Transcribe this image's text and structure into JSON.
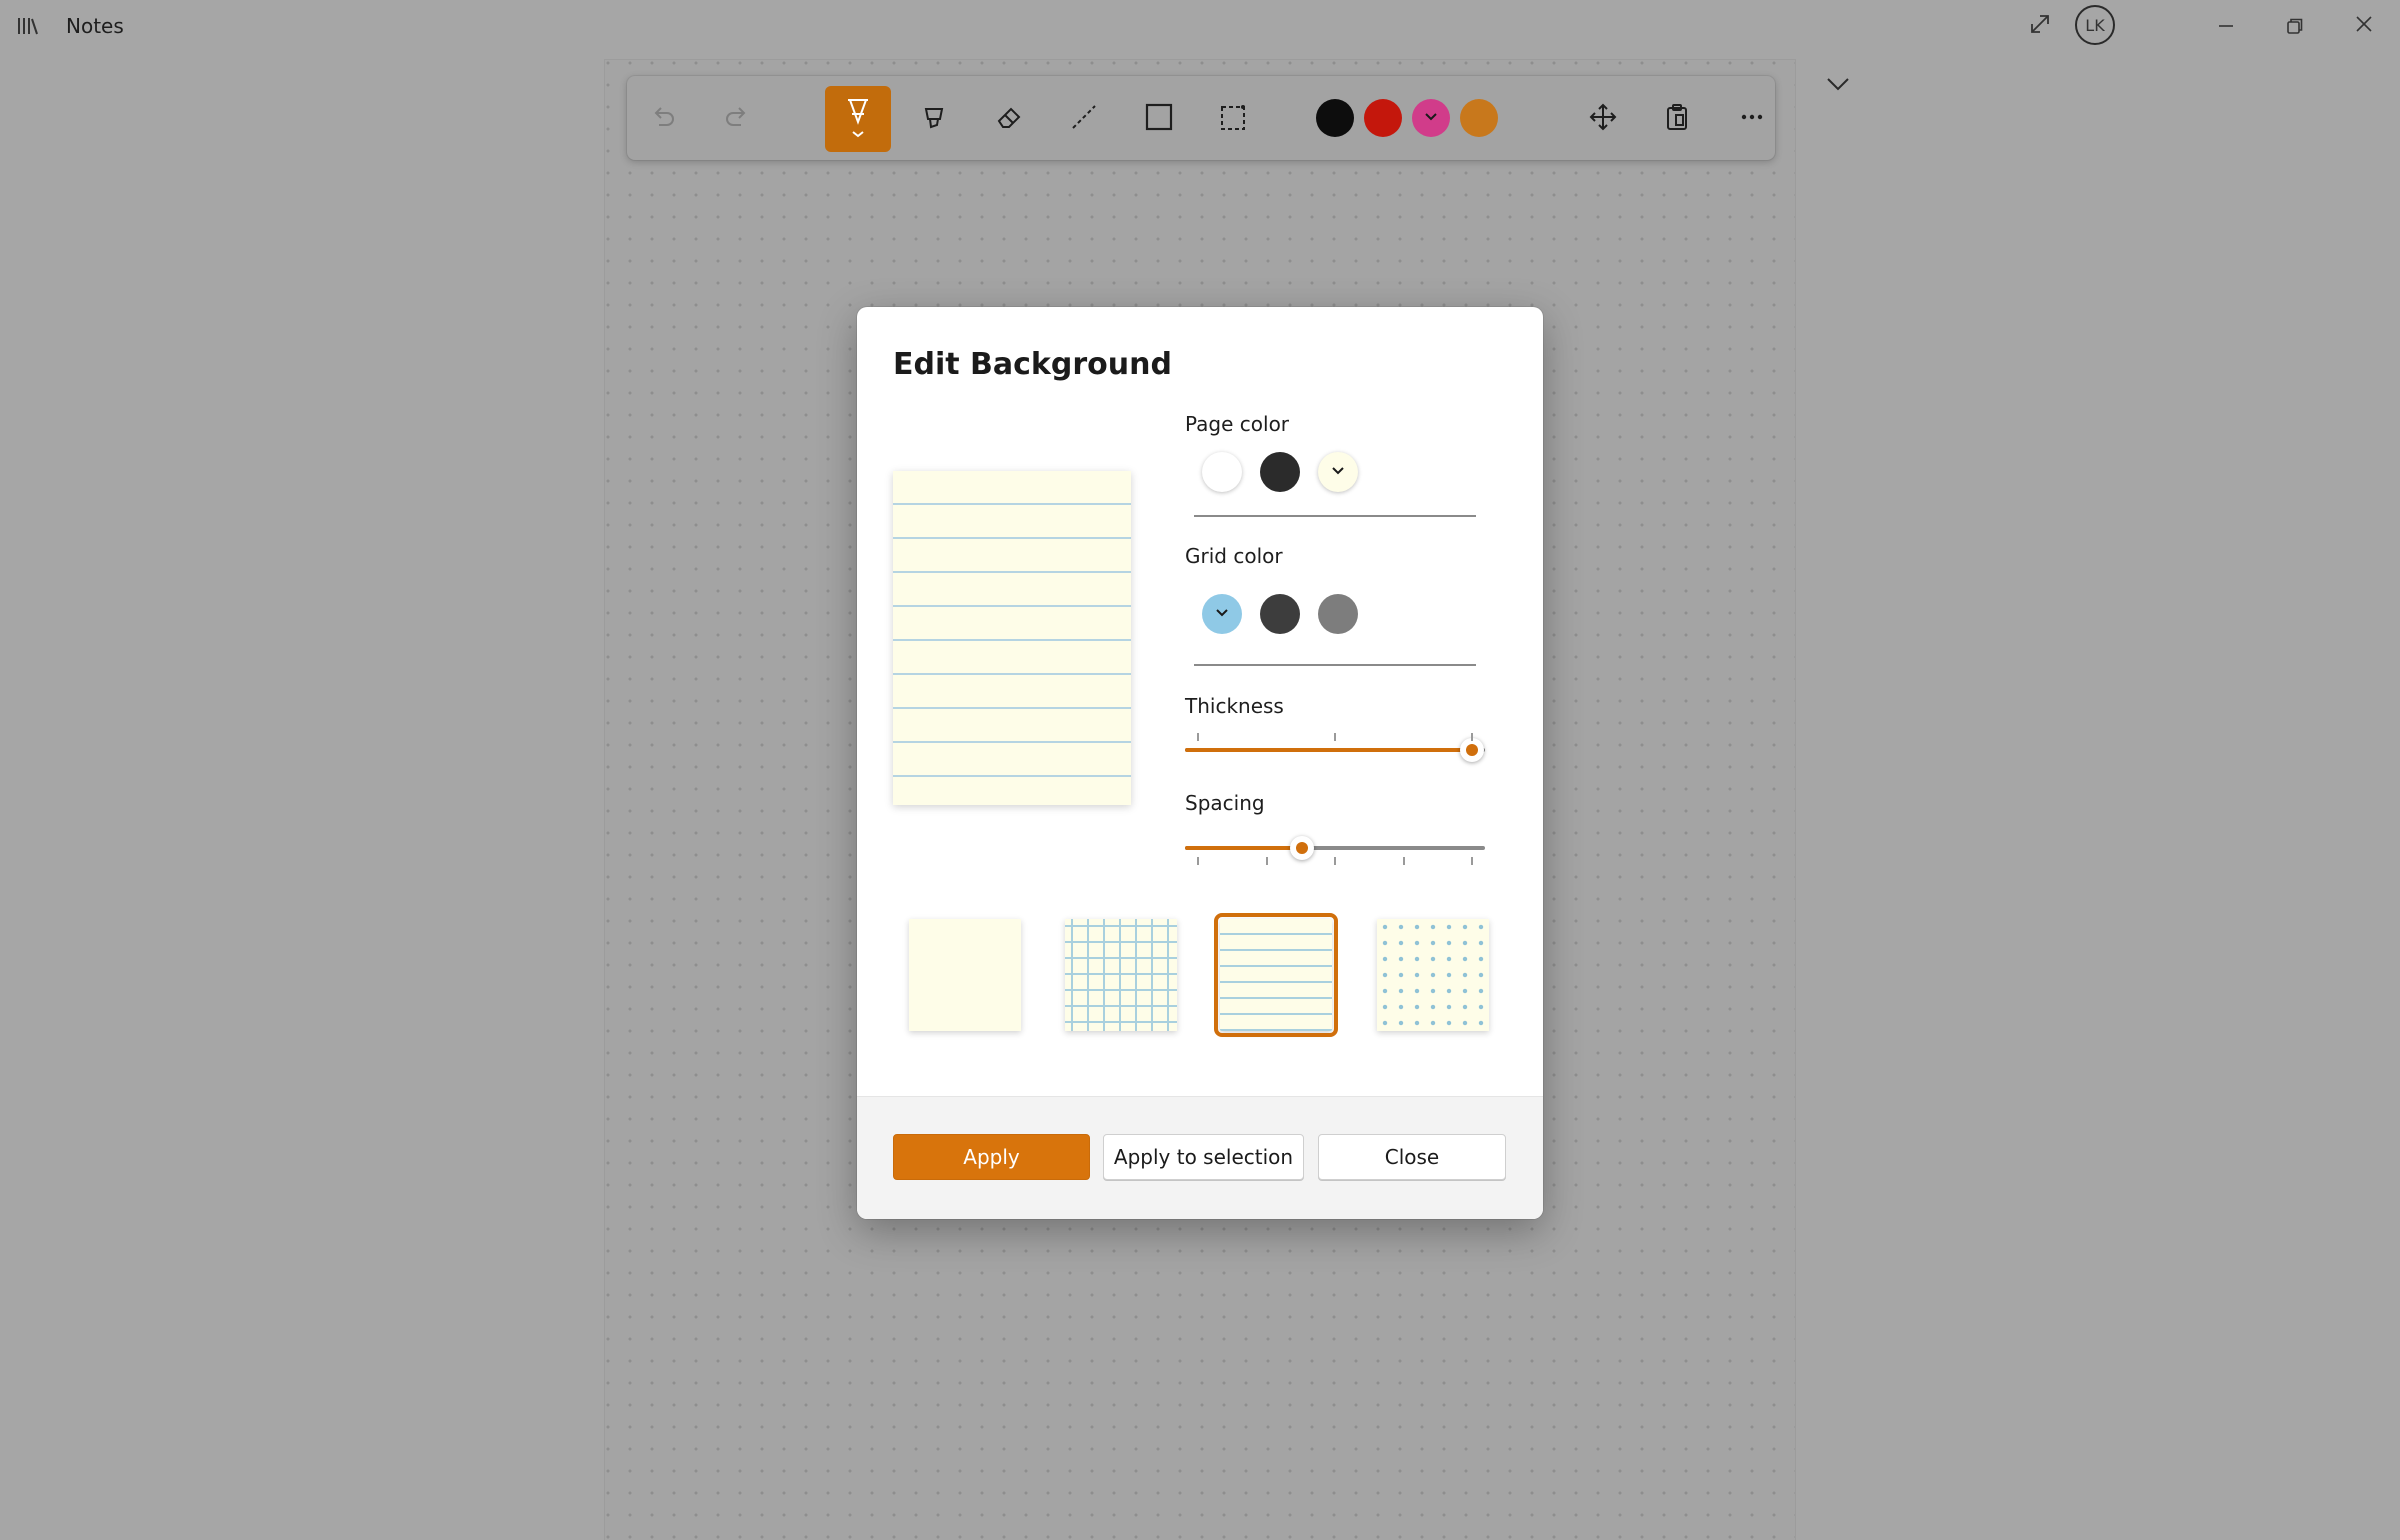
{
  "app": {
    "title": "Notes",
    "avatar_initials": "LK"
  },
  "toolbar": {
    "tools": [
      "undo-icon",
      "redo-icon",
      "pen-icon",
      "highlighter-icon",
      "eraser-icon",
      "line-icon",
      "rectangle-icon",
      "lasso-select-icon",
      "move-icon",
      "paste-icon",
      "more-icon"
    ],
    "active_tool": "pen",
    "ink_colors": [
      "#0d0d0d",
      "#c4170c",
      "#d13c8a",
      "#c8781c"
    ]
  },
  "dialog": {
    "title": "Edit Background",
    "page_color": {
      "label": "Page color",
      "swatches": [
        "#ffffff",
        "#2b2b2b",
        "#fefde8"
      ],
      "selected_index": 2
    },
    "grid_color": {
      "label": "Grid color",
      "swatches": [
        "#8fc9e6",
        "#3d3d3d",
        "#7d7d7d"
      ],
      "selected_index": 0
    },
    "thickness": {
      "label": "Thickness",
      "value": 1.0,
      "ticks": 3
    },
    "spacing": {
      "label": "Spacing",
      "value": 0.38,
      "ticks": 5
    },
    "templates": [
      "blank",
      "grid",
      "lined",
      "dotted"
    ],
    "selected_template": "lined",
    "buttons": {
      "apply": "Apply",
      "apply_selection": "Apply to selection",
      "close": "Close"
    }
  },
  "colors": {
    "accent": "#d8740c"
  }
}
